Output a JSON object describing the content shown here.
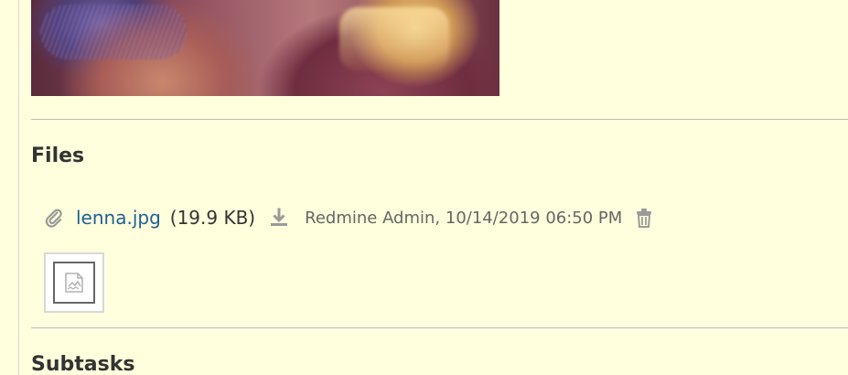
{
  "image": {
    "description": "lenna"
  },
  "files_section": {
    "title": "Files",
    "attachment": {
      "file_name": "lenna.jpg",
      "file_size": "(19.9 KB)",
      "author_and_date": "Redmine Admin, 10/14/2019 06:50 PM",
      "icons": {
        "attachment": "paperclip-icon",
        "download": "download-icon",
        "delete": "trash-icon",
        "thumbnail": "broken-image-icon"
      }
    }
  },
  "subtasks_section": {
    "title": "Subtasks"
  },
  "colors": {
    "background": "#ffffdd",
    "link": "#1f5f93",
    "muted_text": "#666666",
    "icon": "#9a9a9a"
  }
}
